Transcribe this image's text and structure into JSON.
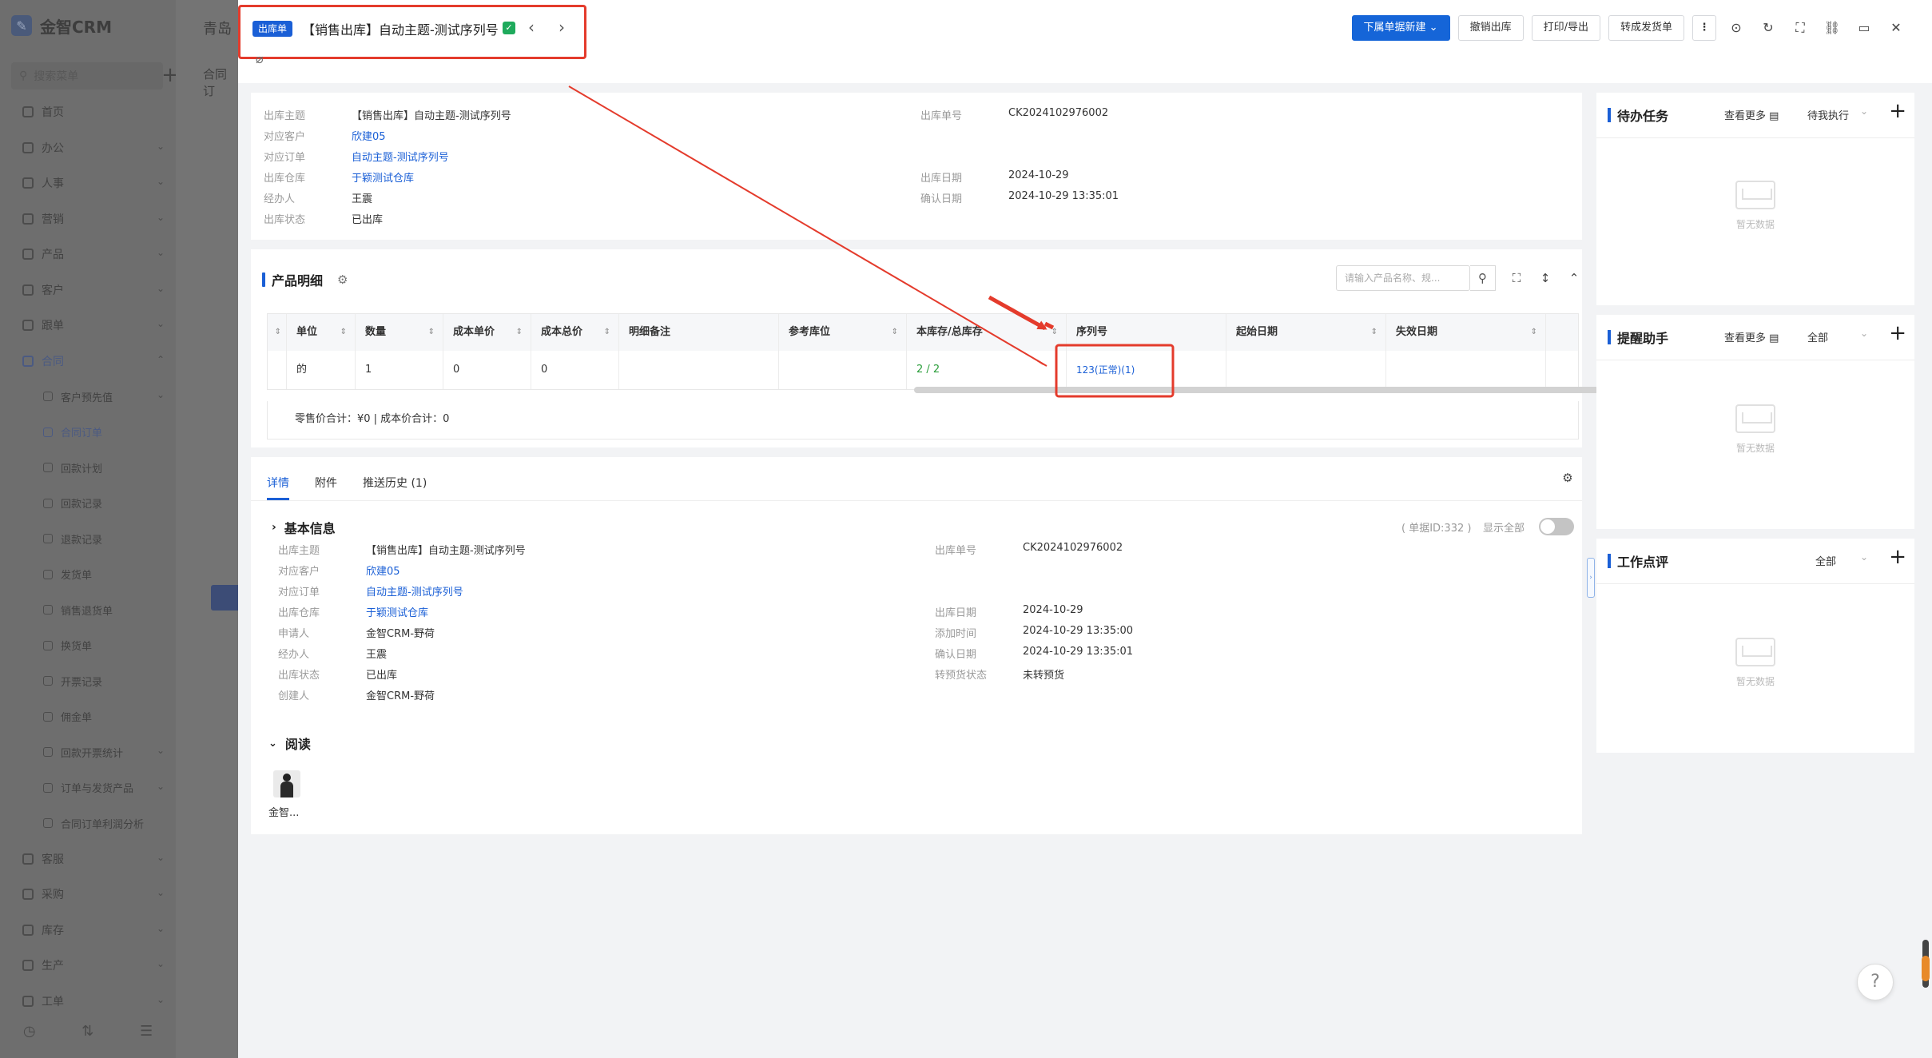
{
  "sidebar": {
    "app_name": "金智CRM",
    "search_placeholder": "搜索菜单",
    "items": [
      {
        "label": "首页"
      },
      {
        "label": "办公"
      },
      {
        "label": "人事"
      },
      {
        "label": "营销"
      },
      {
        "label": "产品"
      },
      {
        "label": "客户"
      },
      {
        "label": "跟单"
      },
      {
        "label": "合同"
      },
      {
        "label": "客户预先值"
      },
      {
        "label": "合同订单"
      },
      {
        "label": "回款计划"
      },
      {
        "label": "回款记录"
      },
      {
        "label": "退款记录"
      },
      {
        "label": "发货单"
      },
      {
        "label": "销售退货单"
      },
      {
        "label": "换货单"
      },
      {
        "label": "开票记录"
      },
      {
        "label": "佣金单"
      },
      {
        "label": "回款开票统计"
      },
      {
        "label": "订单与发货产品"
      },
      {
        "label": "合同订单利润分析"
      },
      {
        "label": "客服"
      },
      {
        "label": "采购"
      },
      {
        "label": "库存"
      },
      {
        "label": "生产"
      },
      {
        "label": "工单"
      }
    ],
    "bg_title": "青岛",
    "bg_subtitle": "合同订"
  },
  "header": {
    "badge": "出库单",
    "title": "【销售出库】自动主题-测试序列号",
    "actions": {
      "new_label": "下属单据新建",
      "revoke_label": "撤销出库",
      "print_label": "打印/导出",
      "convert_label": "转成发货单"
    }
  },
  "summary": {
    "left": [
      {
        "k": "出库主题",
        "v": "【销售出库】自动主题-测试序列号"
      },
      {
        "k": "对应客户",
        "v": "欣建05"
      },
      {
        "k": "对应订单",
        "v": "自动主题-测试序列号"
      },
      {
        "k": "出库仓库",
        "v": "于颖测试仓库"
      },
      {
        "k": "经办人",
        "v": "王震"
      },
      {
        "k": "出库状态",
        "v": "已出库"
      }
    ],
    "right": [
      {
        "k": "出库单号",
        "v": "CK2024102976002"
      },
      {
        "k": "出库日期",
        "v": "2024-10-29"
      },
      {
        "k": "确认日期",
        "v": "2024-10-29 13:35:01"
      }
    ]
  },
  "products": {
    "title": "产品明细",
    "search_placeholder": "请输入产品名称、规...",
    "columns": [
      "单位",
      "数量",
      "成本单价",
      "成本总价",
      "明细备注",
      "参考库位",
      "本库存/总库存",
      "序列号",
      "起始日期",
      "失效日期"
    ],
    "row": [
      "的",
      "1",
      "0",
      "0",
      "",
      "",
      "2 / 2",
      "123(正常)(1)",
      "",
      ""
    ],
    "footer": "零售价合计：¥0 |   成本价合计：0"
  },
  "detail": {
    "tabs": [
      "详情",
      "附件",
      "推送历史 (1)"
    ],
    "basic_title": "基本信息",
    "doc_id": "( 单据ID:332 )",
    "show_all": "显示全部",
    "left": [
      {
        "k": "出库主题",
        "v": "【销售出库】自动主题-测试序列号"
      },
      {
        "k": "对应客户",
        "v": "欣建05"
      },
      {
        "k": "对应订单",
        "v": "自动主题-测试序列号"
      },
      {
        "k": "出库仓库",
        "v": "于颖测试仓库"
      },
      {
        "k": "申请人",
        "v": "金智CRM-野荷"
      },
      {
        "k": "经办人",
        "v": "王震"
      },
      {
        "k": "出库状态",
        "v": "已出库"
      },
      {
        "k": "创建人",
        "v": "金智CRM-野荷"
      }
    ],
    "right": [
      {
        "k": "出库单号",
        "v": "CK2024102976002"
      },
      {
        "k": "出库日期",
        "v": "2024-10-29"
      },
      {
        "k": "添加时间",
        "v": "2024-10-29 13:35:00"
      },
      {
        "k": "确认日期",
        "v": "2024-10-29 13:35:01"
      },
      {
        "k": "转预货状态",
        "v": "未转预货"
      }
    ],
    "read_title": "阅读",
    "reader_name": "金智..."
  },
  "widgets": {
    "todo": {
      "title": "待办任务",
      "more": "查看更多",
      "filter": "待我执行",
      "empty": "暂无数据"
    },
    "remind": {
      "title": "提醒助手",
      "more": "查看更多",
      "filter": "全部",
      "empty": "暂无数据"
    },
    "review": {
      "title": "工作点评",
      "filter": "全部",
      "empty": "暂无数据"
    }
  },
  "colors": {
    "accent": "#1565d8",
    "annotation": "#e43b2c",
    "stock_green": "#2a9d3a"
  }
}
